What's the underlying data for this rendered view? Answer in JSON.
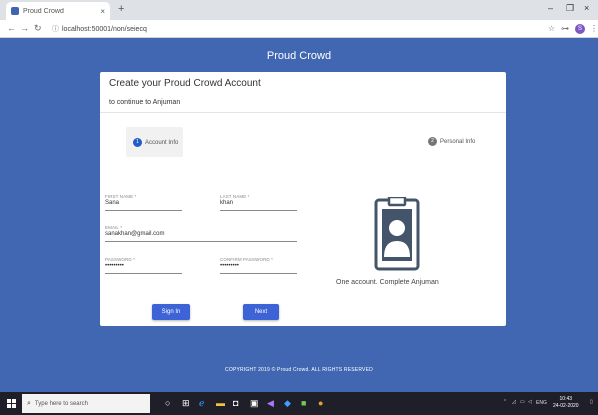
{
  "browser": {
    "tab_title": "Proud Crowd",
    "tab_close": "×",
    "new_tab": "+",
    "url": "localhost:50001/non/seiecq",
    "window_controls": {
      "minimize": "–",
      "maximize": "❐",
      "close": "×"
    },
    "profile_initial": "S"
  },
  "app": {
    "header_title": "Proud Crowd",
    "card": {
      "title": "Create your Proud Crowd Account",
      "subtitle": "to continue to Anjuman"
    },
    "steps": [
      {
        "number": "1",
        "label": "Account Info"
      },
      {
        "number": "2",
        "label": "Personal Info"
      }
    ],
    "fields": {
      "first_name": {
        "label": "FIRST NAME *",
        "value": "Sana"
      },
      "last_name": {
        "label": "LAST NAME *",
        "value": "khan"
      },
      "email": {
        "label": "EMAIL *",
        "value": "sanakhan@gmail.com"
      },
      "password": {
        "label": "PASSWORD *",
        "value": "•••••••••"
      },
      "confirm_password": {
        "label": "CONFIRM PASSWORD *",
        "value": "•••••••••"
      }
    },
    "buttons": {
      "sign_in": "Sign In",
      "next": "Next"
    },
    "tagline": "One account. Complete Anjuman",
    "footer": "COPYRIGHT 2019 © Proud Crowd. ALL RIGHTS RESERVED",
    "colors": {
      "primary": "#4267b2",
      "button": "#3d63d6",
      "step_active": "#1f5cc7"
    }
  },
  "taskbar": {
    "search_placeholder": "Type here to search",
    "language": "ENG",
    "time": "10:43",
    "date": "24-02-2020"
  }
}
